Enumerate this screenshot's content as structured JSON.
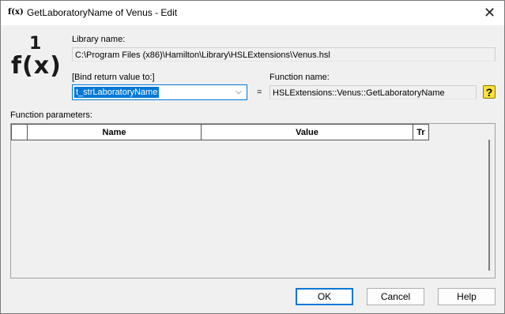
{
  "window": {
    "icon_glyph": "f(x)",
    "title": "GetLaboratoryName of Venus - Edit",
    "close_glyph": "✕"
  },
  "logo": {
    "one": "1",
    "fx": "f(x)"
  },
  "library": {
    "label": "Library name:",
    "value": "C:\\Program Files (x86)\\Hamilton\\Library\\HSLExtensions\\Venus.hsl"
  },
  "bind": {
    "label": "[Bind return value to:]",
    "value": "t_strLaboratoryName",
    "arrow_glyph": "⌵"
  },
  "equals": "=",
  "function": {
    "label": "Function name:",
    "value": "HSLExtensions::Venus::GetLaboratoryName",
    "help_glyph": "?"
  },
  "parameters": {
    "label": "Function parameters:",
    "columns": [
      "Name",
      "Value",
      "Tr"
    ]
  },
  "buttons": {
    "ok": "OK",
    "cancel": "Cancel",
    "help": "Help"
  },
  "colors": {
    "accent": "#0078d7",
    "help_icon": "#ffe03a"
  }
}
